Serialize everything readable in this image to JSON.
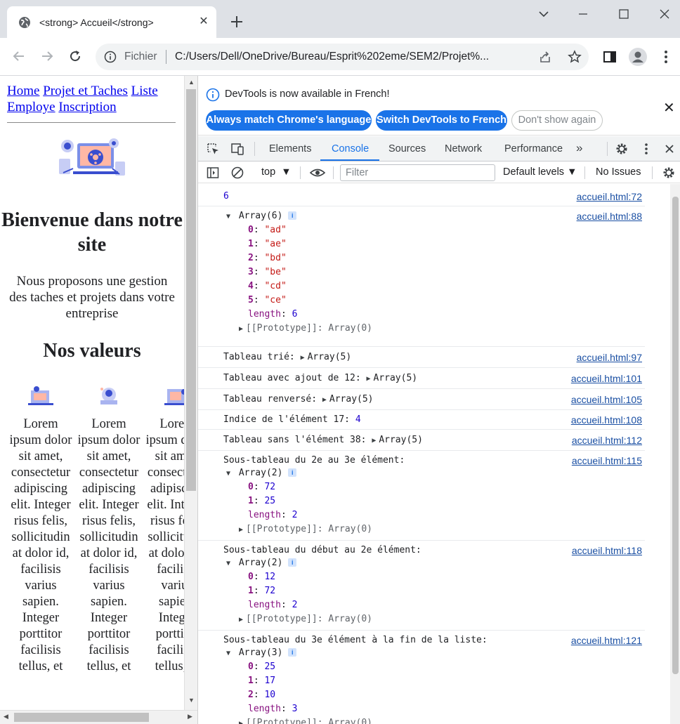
{
  "browser": {
    "tab_title": "<strong> Accueil</strong>",
    "tab_close": "✕",
    "scheme_label": "Fichier",
    "url": "C:/Users/Dell/OneDrive/Bureau/Esprit%202eme/SEM2/Projet%..."
  },
  "page": {
    "nav": [
      "Home",
      "Projet et Taches",
      "Liste Employe",
      "Inscription"
    ],
    "title": "Bienvenue dans notre site",
    "intro": "Nous proposons une gestion des taches et projets dans votre entreprise",
    "values_title": "Nos valeurs",
    "value_text": "Lorem ipsum dolor sit amet, consectetur adipiscing elit. Integer risus felis, sollicitudin at dolor id, facilisis varius sapien. Integer porttitor facilisis tellus, et"
  },
  "devtools": {
    "infobar": {
      "message": "DevTools is now available in French!",
      "btn_match": "Always match Chrome's language",
      "btn_switch": "Switch DevTools to French",
      "btn_dismiss": "Don't show again"
    },
    "tabs": [
      "Elements",
      "Console",
      "Sources",
      "Network",
      "Performance"
    ],
    "active_tab": "Console",
    "more_tabs": "»",
    "context": "top",
    "filter_placeholder": "Filter",
    "levels": "Default levels",
    "issues": "No Issues"
  },
  "console": {
    "m1": {
      "value": "6",
      "src": "accueil.html:72"
    },
    "m2": {
      "header": "Array(6)",
      "src": "accueil.html:88",
      "items": [
        [
          "0",
          "\"ad\""
        ],
        [
          "1",
          "\"ae\""
        ],
        [
          "2",
          "\"bd\""
        ],
        [
          "3",
          "\"be\""
        ],
        [
          "4",
          "\"cd\""
        ],
        [
          "5",
          "\"ce\""
        ]
      ],
      "length_key": "length",
      "length": "6",
      "proto": "[[Prototype]]: Array(0)"
    },
    "m3": {
      "label": "Tableau trié:",
      "value": "Array(5)",
      "src": "accueil.html:97"
    },
    "m4": {
      "label": "Tableau avec ajout de 12:",
      "value": "Array(5)",
      "src": "accueil.html:101"
    },
    "m5": {
      "label": "Tableau renversé:",
      "value": "Array(5)",
      "src": "accueil.html:105"
    },
    "m6": {
      "label": "Indice de l'élément 17:",
      "value": "4",
      "src": "accueil.html:108"
    },
    "m7": {
      "label": "Tableau sans l'élément 38:",
      "value": "Array(5)",
      "src": "accueil.html:112"
    },
    "m8": {
      "label": "Sous-tableau du 2e au 3e élément:",
      "header": "Array(2)",
      "src": "accueil.html:115",
      "items": [
        [
          "0",
          "72"
        ],
        [
          "1",
          "25"
        ]
      ],
      "length": "2",
      "proto": "[[Prototype]]: Array(0)"
    },
    "m9": {
      "label": "Sous-tableau du début au 2e élément:",
      "header": "Array(2)",
      "src": "accueil.html:118",
      "items": [
        [
          "0",
          "12"
        ],
        [
          "1",
          "72"
        ]
      ],
      "length": "2",
      "proto": "[[Prototype]]: Array(0)"
    },
    "m10": {
      "label": "Sous-tableau du 3e élément à la fin de la liste:",
      "header": "Array(3)",
      "src": "accueil.html:121",
      "items": [
        [
          "0",
          "25"
        ],
        [
          "1",
          "17"
        ],
        [
          "2",
          "10"
        ]
      ],
      "length": "3",
      "proto": "[[Prototype]]: Array(0)"
    }
  },
  "colors": {
    "accent": "#1a73e8",
    "link": "#0000ee",
    "string": "#c41a16",
    "number": "#1c00cf",
    "key": "#881280"
  }
}
